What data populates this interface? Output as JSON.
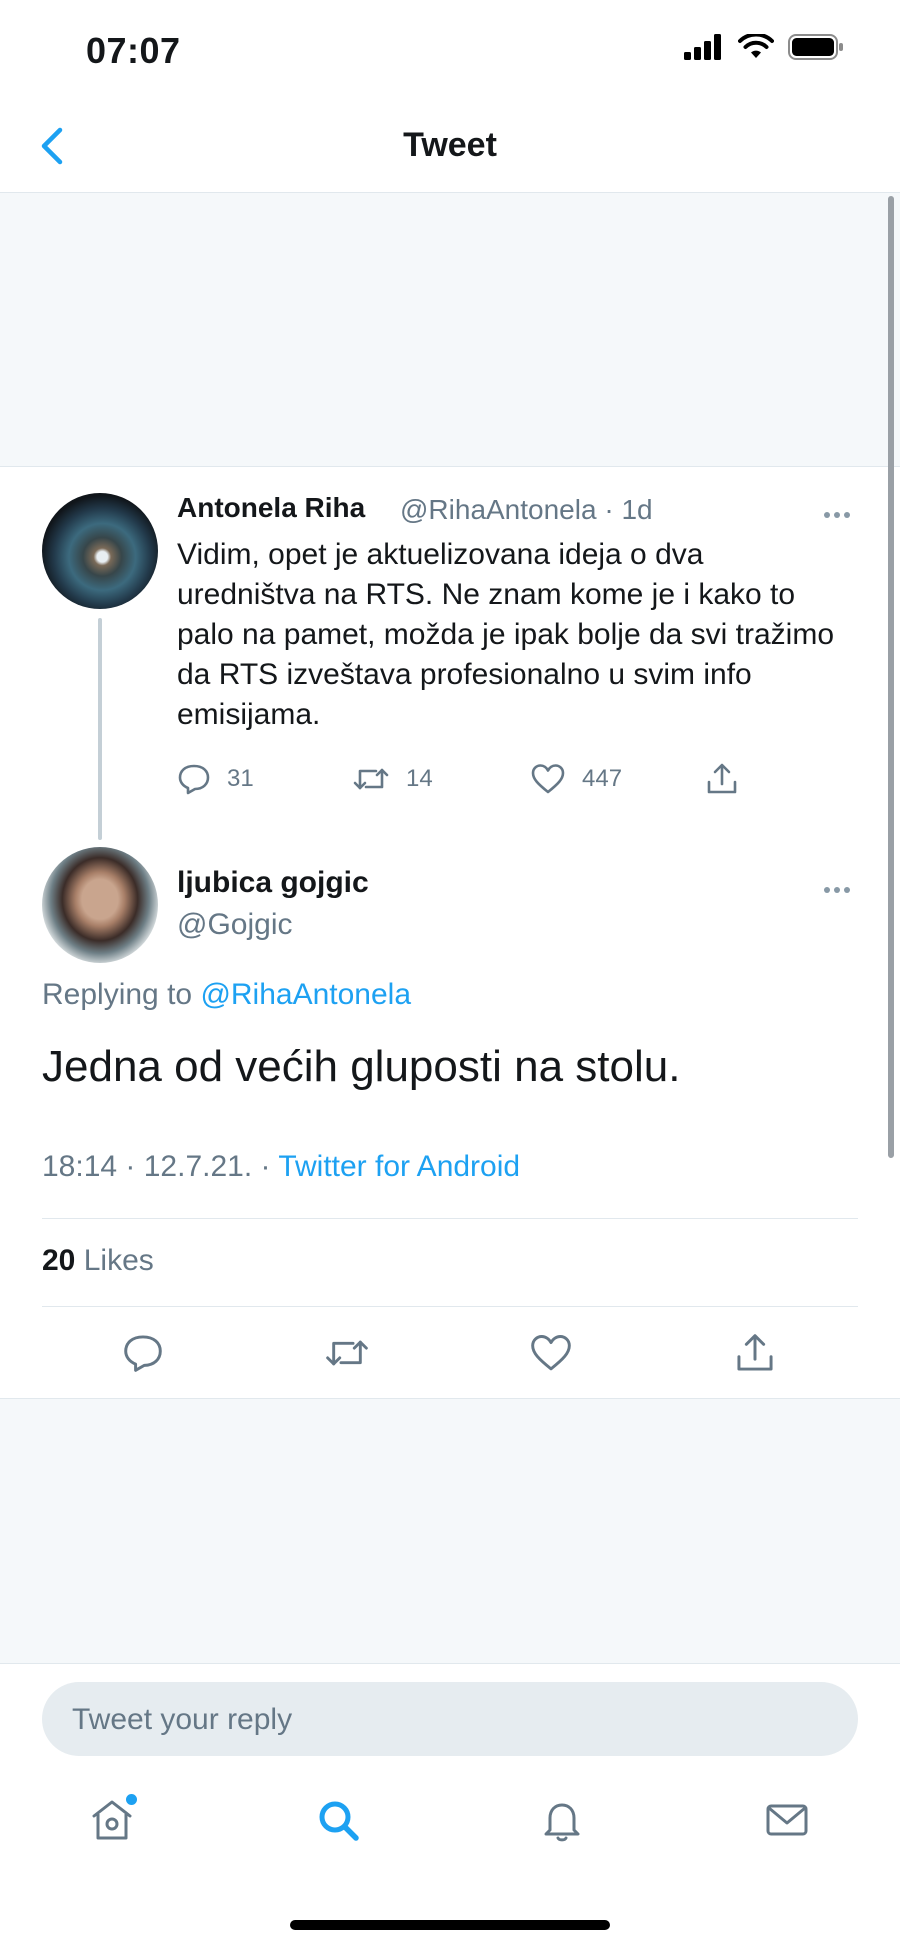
{
  "status_bar": {
    "time": "07:07"
  },
  "nav": {
    "title": "Tweet"
  },
  "parent_tweet": {
    "name": "Antonela Riha",
    "handle": "@RihaAntonela",
    "age": "1d",
    "text": "Vidim, opet je aktuelizovana ideja o dva uredništva na RTS. Ne znam kome je i kako to palo na pamet, možda je ipak bolje da svi tražimo da RTS izveštava profesionalno u svim info emisijama.",
    "replies": "31",
    "retweets": "14",
    "likes": "447"
  },
  "reply_tweet": {
    "name": "ljubica gojgic",
    "handle": "@Gojgic",
    "replying_prefix": "Replying to",
    "replying_to": "@RihaAntonela",
    "text": "Jedna od većih gluposti na stolu.",
    "time": "18:14",
    "date": "12.7.21.",
    "source": "Twitter for Android",
    "likes_count": "20",
    "likes_label": "Likes"
  },
  "reply_box": {
    "placeholder": "Tweet your reply"
  },
  "tabbar": {
    "icons": [
      "home-icon",
      "search-icon",
      "notifications-icon",
      "messages-icon"
    ],
    "active": "search-icon"
  },
  "colors": {
    "accent": "#1da1f2",
    "muted": "#657786",
    "text": "#14171a",
    "background_grey": "#f5f8fa"
  }
}
